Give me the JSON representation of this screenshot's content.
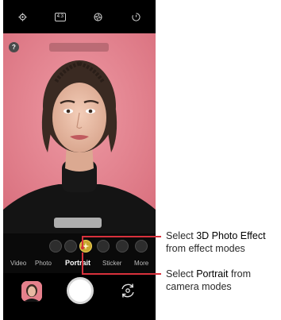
{
  "top_bar": {
    "ratio_label": "4:3",
    "icons": [
      "gear-icon",
      "aperture-icon",
      "timer-icon"
    ]
  },
  "viewfinder": {
    "help_label": "?"
  },
  "modes": {
    "items": [
      {
        "label": "Video"
      },
      {
        "label": "Photo"
      },
      {
        "label": "Portrait",
        "active": true
      },
      {
        "label": "Sticker"
      },
      {
        "label": "More"
      }
    ]
  },
  "effects": {
    "count": 6,
    "selected_index": 2
  },
  "callouts": {
    "effect": {
      "line1_prefix": "Select ",
      "line1_bold": "3D Photo Effect",
      "line2": "from effect modes"
    },
    "mode": {
      "line1_prefix": "Select ",
      "line1_bold": "Portrait",
      "line1_suffix": " from",
      "line2": "camera modes"
    }
  },
  "colors": {
    "accent_red": "#d8313c",
    "viewfinder_bg": "#e6808c",
    "selected_effect": "#c8a72e"
  }
}
